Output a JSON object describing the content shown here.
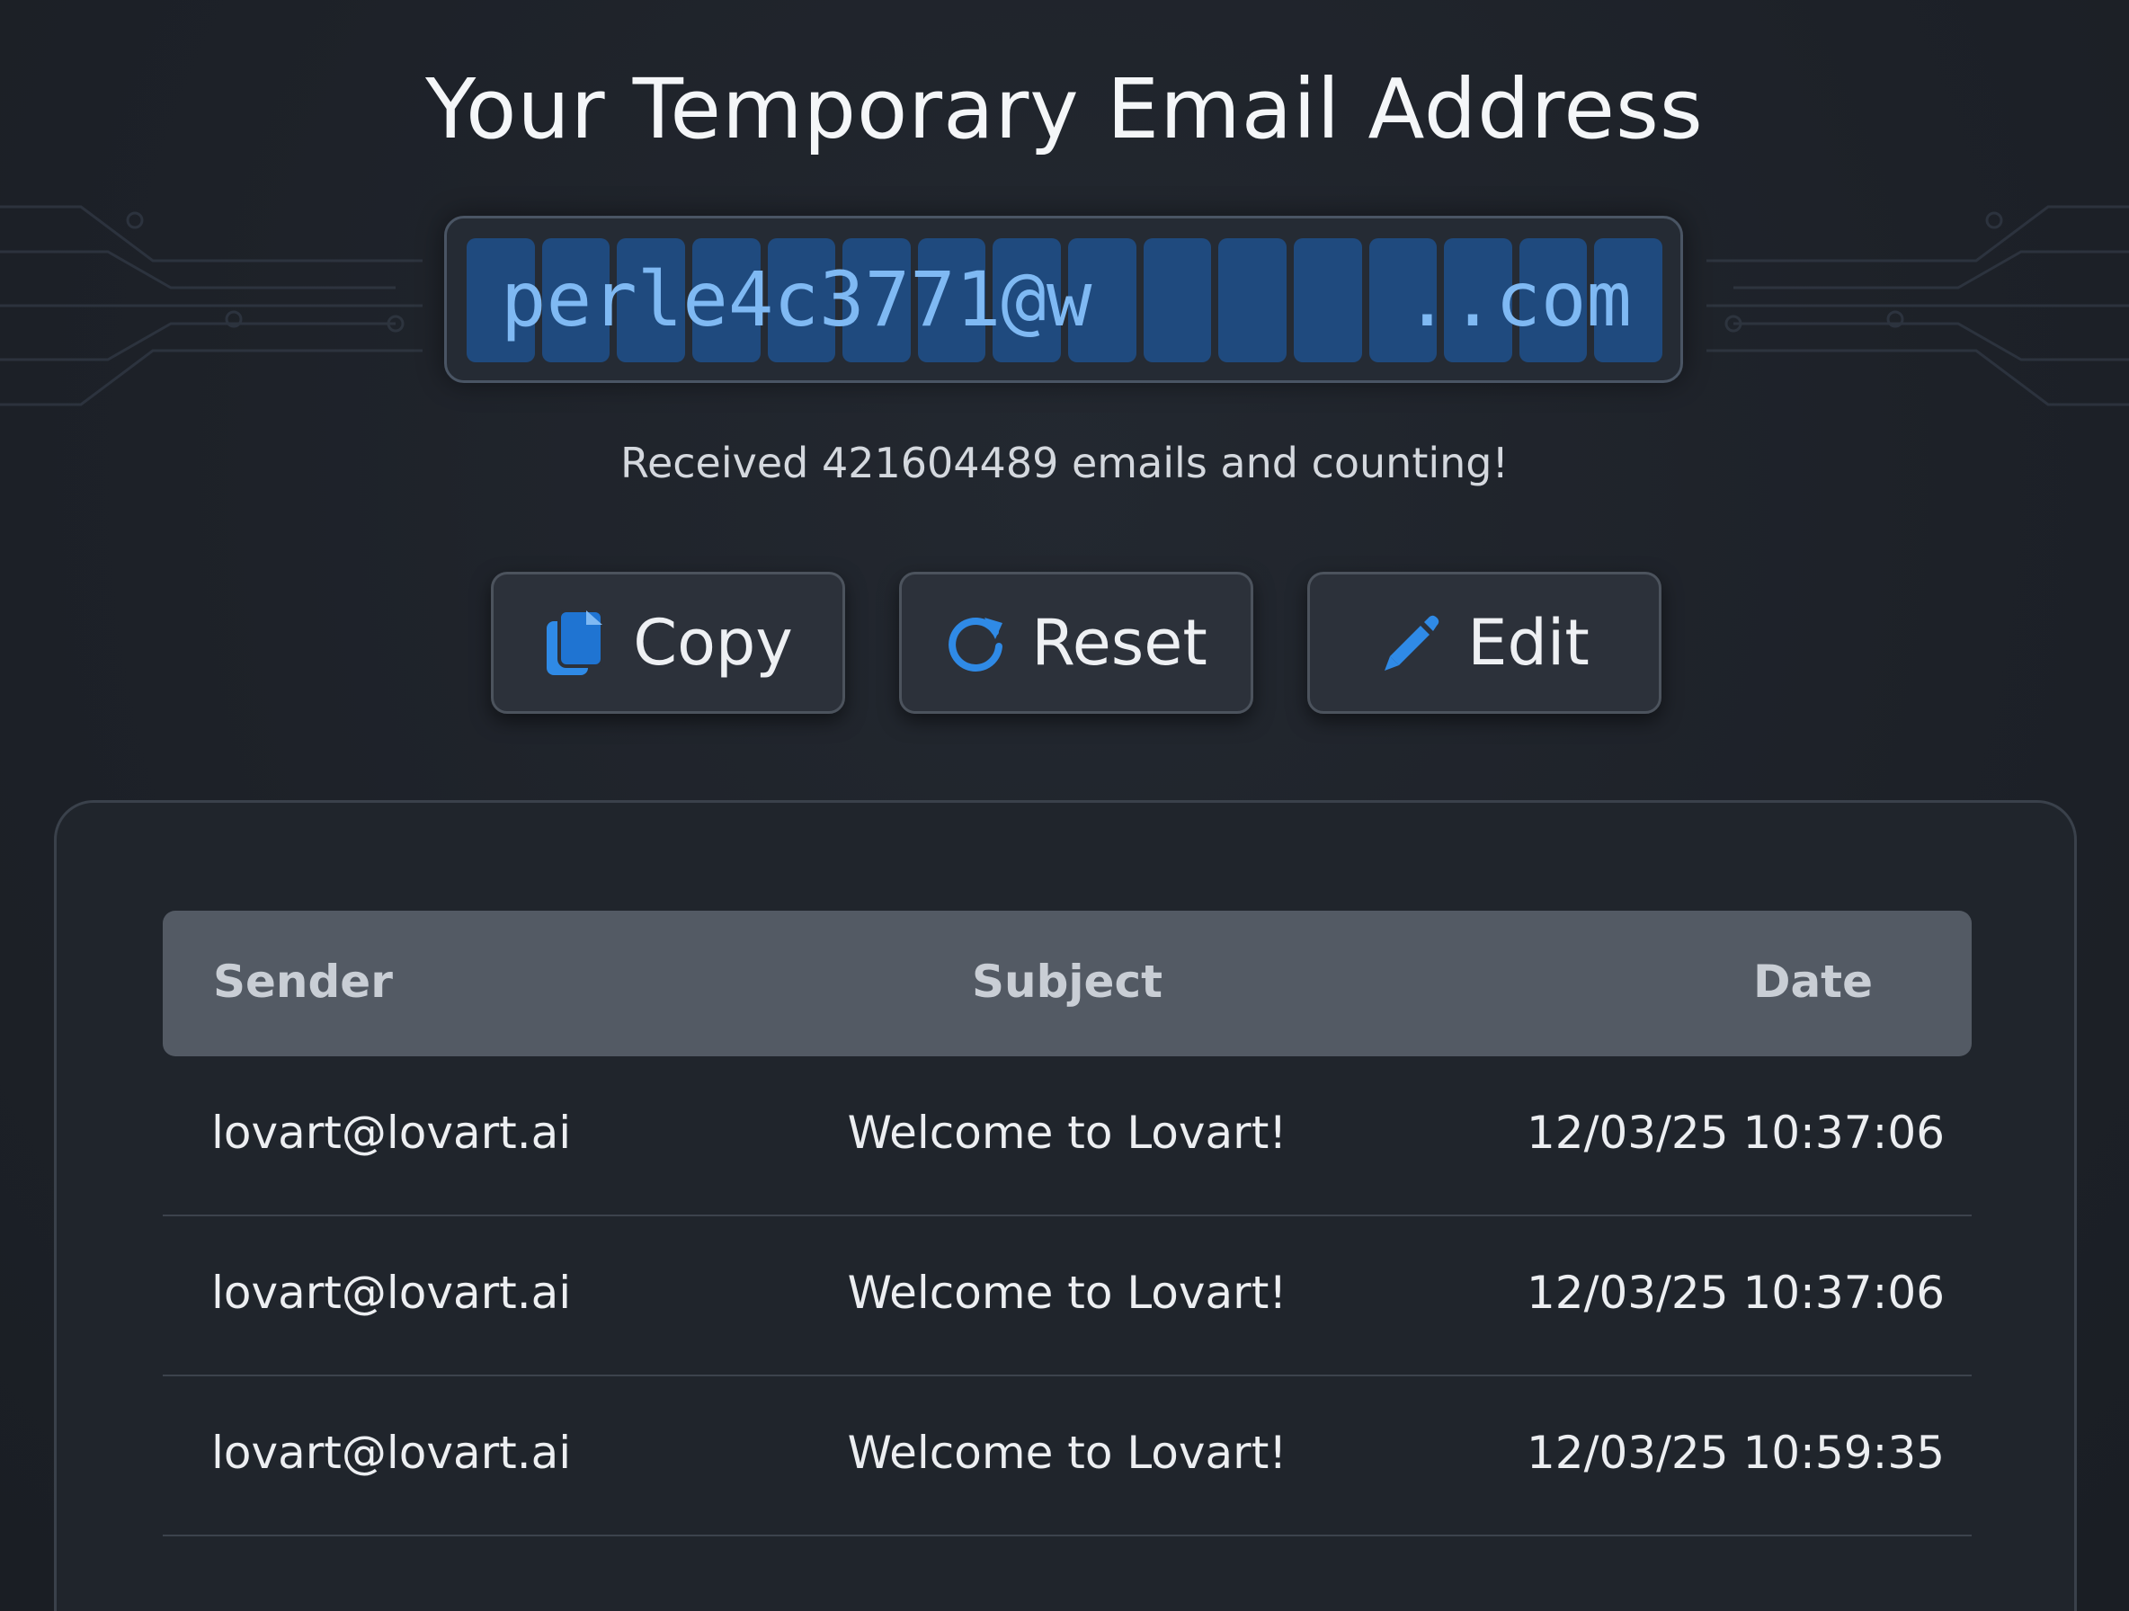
{
  "title": "Your Temporary Email Address",
  "address": {
    "local_part": "perle4c3771@w",
    "suffix": "..com"
  },
  "counter_text": "Received 421604489 emails and counting!",
  "buttons": {
    "copy": {
      "label": "Copy",
      "icon": "copy-icon"
    },
    "reset": {
      "label": "Reset",
      "icon": "refresh-icon"
    },
    "edit": {
      "label": "Edit",
      "icon": "pencil-icon"
    }
  },
  "inbox": {
    "columns": {
      "sender": "Sender",
      "subject": "Subject",
      "date": "Date"
    },
    "rows": [
      {
        "sender": "lovart@lovart.ai",
        "subject": "Welcome to Lovart!",
        "date": "12/03/25 10:37:06"
      },
      {
        "sender": "lovart@lovart.ai",
        "subject": "Welcome to Lovart!",
        "date": "12/03/25 10:37:06"
      },
      {
        "sender": "lovart@lovart.ai",
        "subject": "Welcome to Lovart!",
        "date": "12/03/25 10:59:35"
      }
    ]
  },
  "colors": {
    "accent": "#2f8ae6",
    "address_text": "#7fb9f3",
    "address_cell": "#1f4a7e",
    "background": "#1e2229"
  }
}
